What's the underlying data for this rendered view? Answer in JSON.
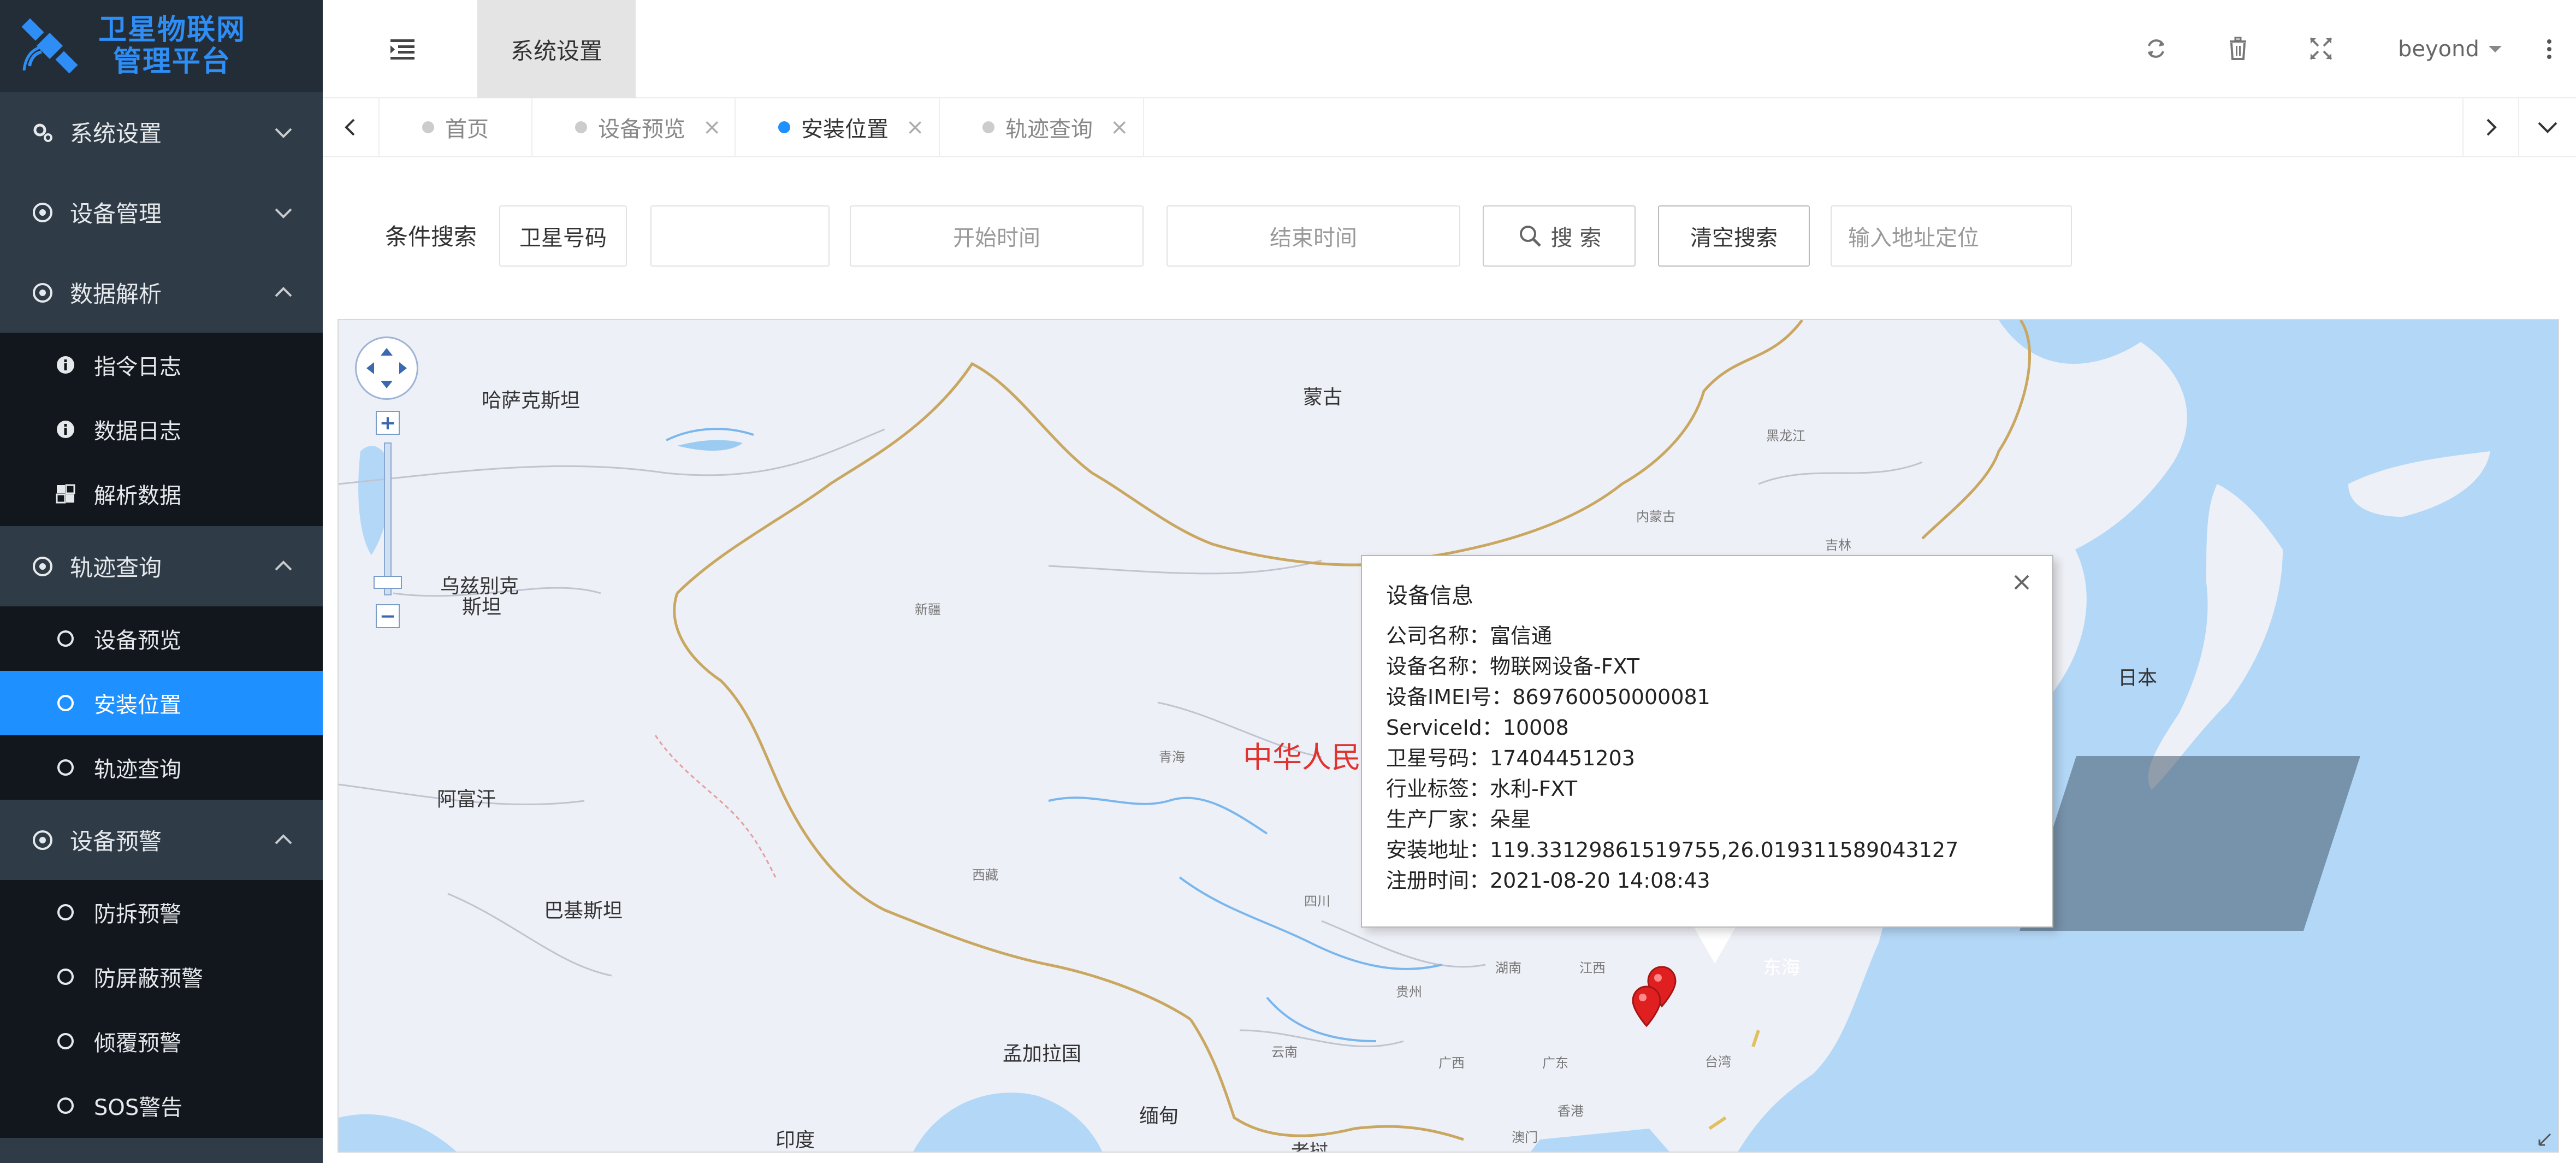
{
  "logo": {
    "line1": "卫星物联网",
    "line2": "管理平台"
  },
  "sidebar": {
    "groups": [
      {
        "label": "系统设置",
        "icon": "gears-icon",
        "expanded": false
      },
      {
        "label": "设备管理",
        "icon": "target-icon",
        "expanded": false
      },
      {
        "label": "数据解析",
        "icon": "target-icon",
        "expanded": true,
        "items": [
          {
            "label": "指令日志",
            "icon": "info-icon"
          },
          {
            "label": "数据日志",
            "icon": "info-icon"
          },
          {
            "label": "解析数据",
            "icon": "puzzle-icon"
          }
        ]
      },
      {
        "label": "轨迹查询",
        "icon": "target-icon",
        "expanded": true,
        "items": [
          {
            "label": "设备预览",
            "icon": "circle-icon"
          },
          {
            "label": "安装位置",
            "icon": "circle-icon",
            "active": true
          },
          {
            "label": "轨迹查询",
            "icon": "circle-icon"
          }
        ]
      },
      {
        "label": "设备预警",
        "icon": "target-icon",
        "expanded": true,
        "items": [
          {
            "label": "防拆预警",
            "icon": "circle-icon"
          },
          {
            "label": "防屏蔽预警",
            "icon": "circle-icon"
          },
          {
            "label": "倾覆预警",
            "icon": "circle-icon"
          },
          {
            "label": "SOS警告",
            "icon": "circle-icon"
          }
        ]
      }
    ]
  },
  "header": {
    "active_module": "系统设置",
    "user": "beyond",
    "icons": [
      "refresh-icon",
      "trash-icon",
      "fullscreen-icon",
      "more-vertical-icon"
    ]
  },
  "tabs": [
    {
      "label": "首页",
      "closable": false,
      "active": false
    },
    {
      "label": "设备预览",
      "closable": true,
      "active": false
    },
    {
      "label": "安装位置",
      "closable": true,
      "active": true
    },
    {
      "label": "轨迹查询",
      "closable": true,
      "active": false
    }
  ],
  "tab_close_glyph": "×",
  "search": {
    "label": "条件搜索",
    "select_value": "卫星号码",
    "keyword_value": "",
    "start_placeholder": "开始时间",
    "end_placeholder": "结束时间",
    "search_label": "搜 索",
    "clear_label": "清空搜索",
    "address_placeholder": "输入地址定位"
  },
  "map": {
    "zoom_plus": "+",
    "zoom_minus": "−",
    "labels": {
      "kazakhstan": "哈萨克斯坦",
      "mongolia": "蒙古",
      "uzbekistan_1": "乌兹别克",
      "uzbekistan_2": "斯坦",
      "afghanistan": "阿富汗",
      "pakistan": "巴基斯坦",
      "bangladesh": "孟加拉国",
      "india": "印度",
      "myanmar": "缅甸",
      "japan": "日本",
      "east_sea": "东海",
      "china": "中华人民",
      "xinjiang": "新疆",
      "qinghai": "青海",
      "tibet": "西藏",
      "sichuan": "四川",
      "neimenggu": "内蒙古",
      "heilongjiang": "黑龙江",
      "jilin": "吉林",
      "hunan": "湖南",
      "jiangxi": "江西",
      "guizhou": "贵州",
      "yunnan": "云南",
      "guangxi": "广西",
      "guangdong": "广东",
      "taiwan": "台湾",
      "hongkong": "香港",
      "macau": "澳门",
      "laos": "老挝"
    },
    "popup": {
      "title": "设备信息",
      "rows": [
        "公司名称：富信通",
        "设备名称：物联网设备-FXT",
        "设备IMEI号：869760050000081",
        "ServiceId：10008",
        "卫星号码：17404451203",
        "行业标签：水利-FXT",
        "生产厂家：朵星",
        "安装地址：119.33129861519755,26.019311589043127",
        "注册时间：2021-08-20 14:08:43"
      ]
    },
    "marker_color": "#e02020"
  },
  "colors": {
    "sidebar_bg": "#2f3b46",
    "submenu_bg": "#11171d",
    "active_blue": "#1e90ff",
    "logo_blue": "#2e8ef5"
  }
}
